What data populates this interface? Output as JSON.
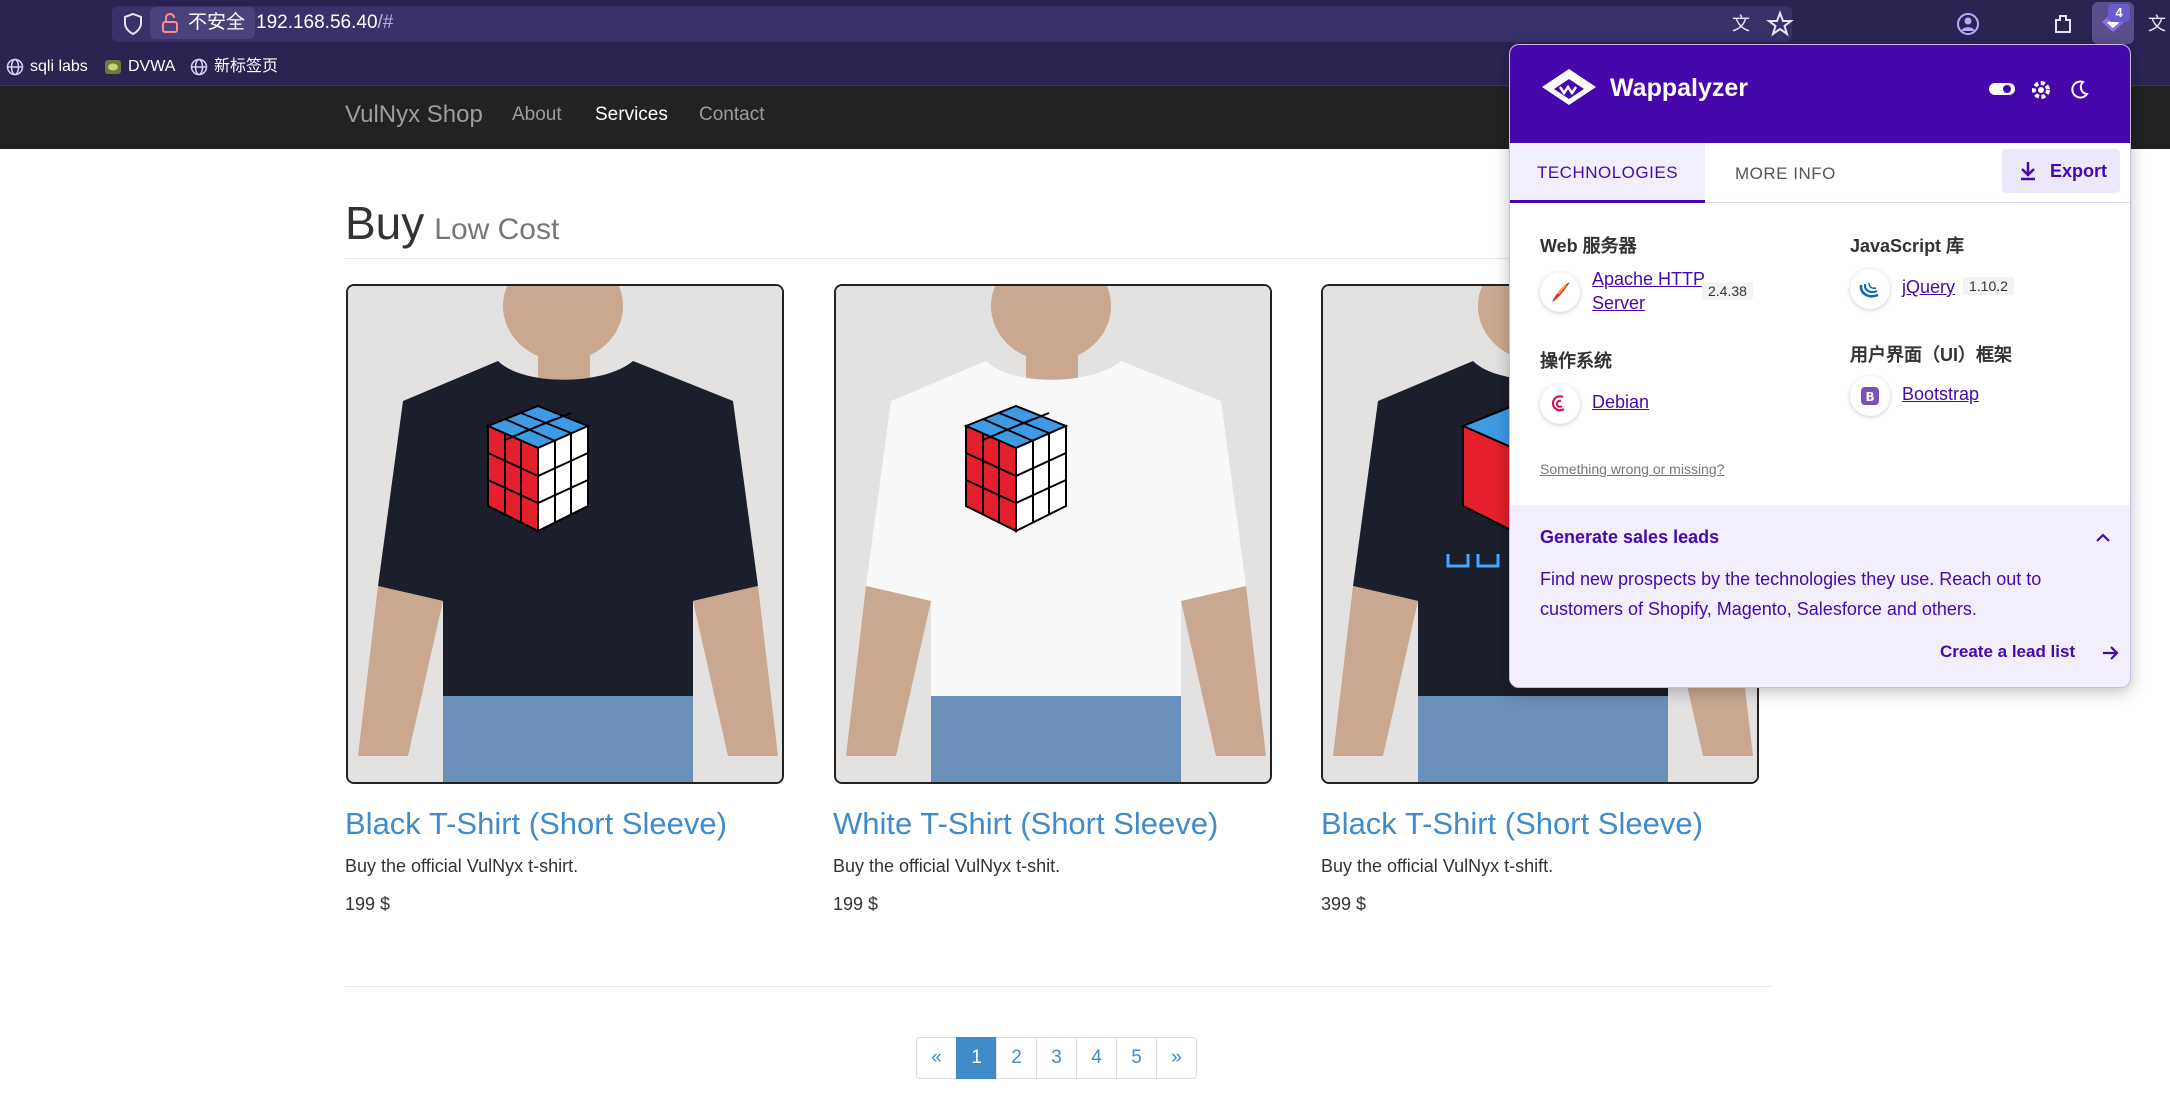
{
  "browser": {
    "insecure_label": "不安全",
    "url_host": "192.168.56.40",
    "url_path": "/#",
    "extension_badge": "4",
    "bookmarks": [
      {
        "label": "sqli labs"
      },
      {
        "label": "DVWA"
      },
      {
        "label": "新标签页"
      }
    ]
  },
  "site": {
    "brand": "VulNyx Shop",
    "nav": [
      "About",
      "Services",
      "Contact"
    ],
    "active_nav": "Services",
    "heading": "Buy",
    "heading_small": "Low Cost",
    "products": [
      {
        "title": "Black T-Shirt (Short Sleeve)",
        "desc": "Buy the official VulNyx t-shirt.",
        "price": "199 $",
        "shirt_color": "#1b1e2b"
      },
      {
        "title": "White T-Shirt (Short Sleeve)",
        "desc": "Buy the official VulNyx t-shit.",
        "price": "199 $",
        "shirt_color": "#f8f8f8"
      },
      {
        "title": "Black T-Shirt (Short Sleeve)",
        "desc": "Buy the official VulNyx t-shift.",
        "price": "399 $",
        "shirt_color": "#1b1e2b"
      }
    ],
    "pagination": [
      "«",
      "1",
      "2",
      "3",
      "4",
      "5",
      "»"
    ],
    "active_page": "1"
  },
  "wappalyzer": {
    "title": "Wappalyzer",
    "tabs": [
      "TECHNOLOGIES",
      "MORE INFO"
    ],
    "export_label": "Export",
    "categories": [
      {
        "name": "Web 服务器",
        "tech": "Apache HTTP Server",
        "tech_line1": "Apache HTTP",
        "tech_line2": "Server",
        "version": "2.4.38",
        "icon": "apache-feather-icon"
      },
      {
        "name": "JavaScript 库",
        "tech": "jQuery",
        "version": "1.10.2",
        "icon": "jquery-icon"
      },
      {
        "name": "操作系统",
        "tech": "Debian",
        "version": "",
        "icon": "debian-swirl-icon"
      },
      {
        "name": "用户界面（UI）框架",
        "tech": "Bootstrap",
        "version": "",
        "icon": "bootstrap-icon"
      }
    ],
    "wrong_link": "Something wrong or missing?",
    "leads": {
      "title": "Generate sales leads",
      "text": "Find new prospects by the technologies they use. Reach out to customers of Shopify, Magento, Salesforce and others.",
      "link": "Create a lead list"
    },
    "accent": "#4608ad"
  }
}
